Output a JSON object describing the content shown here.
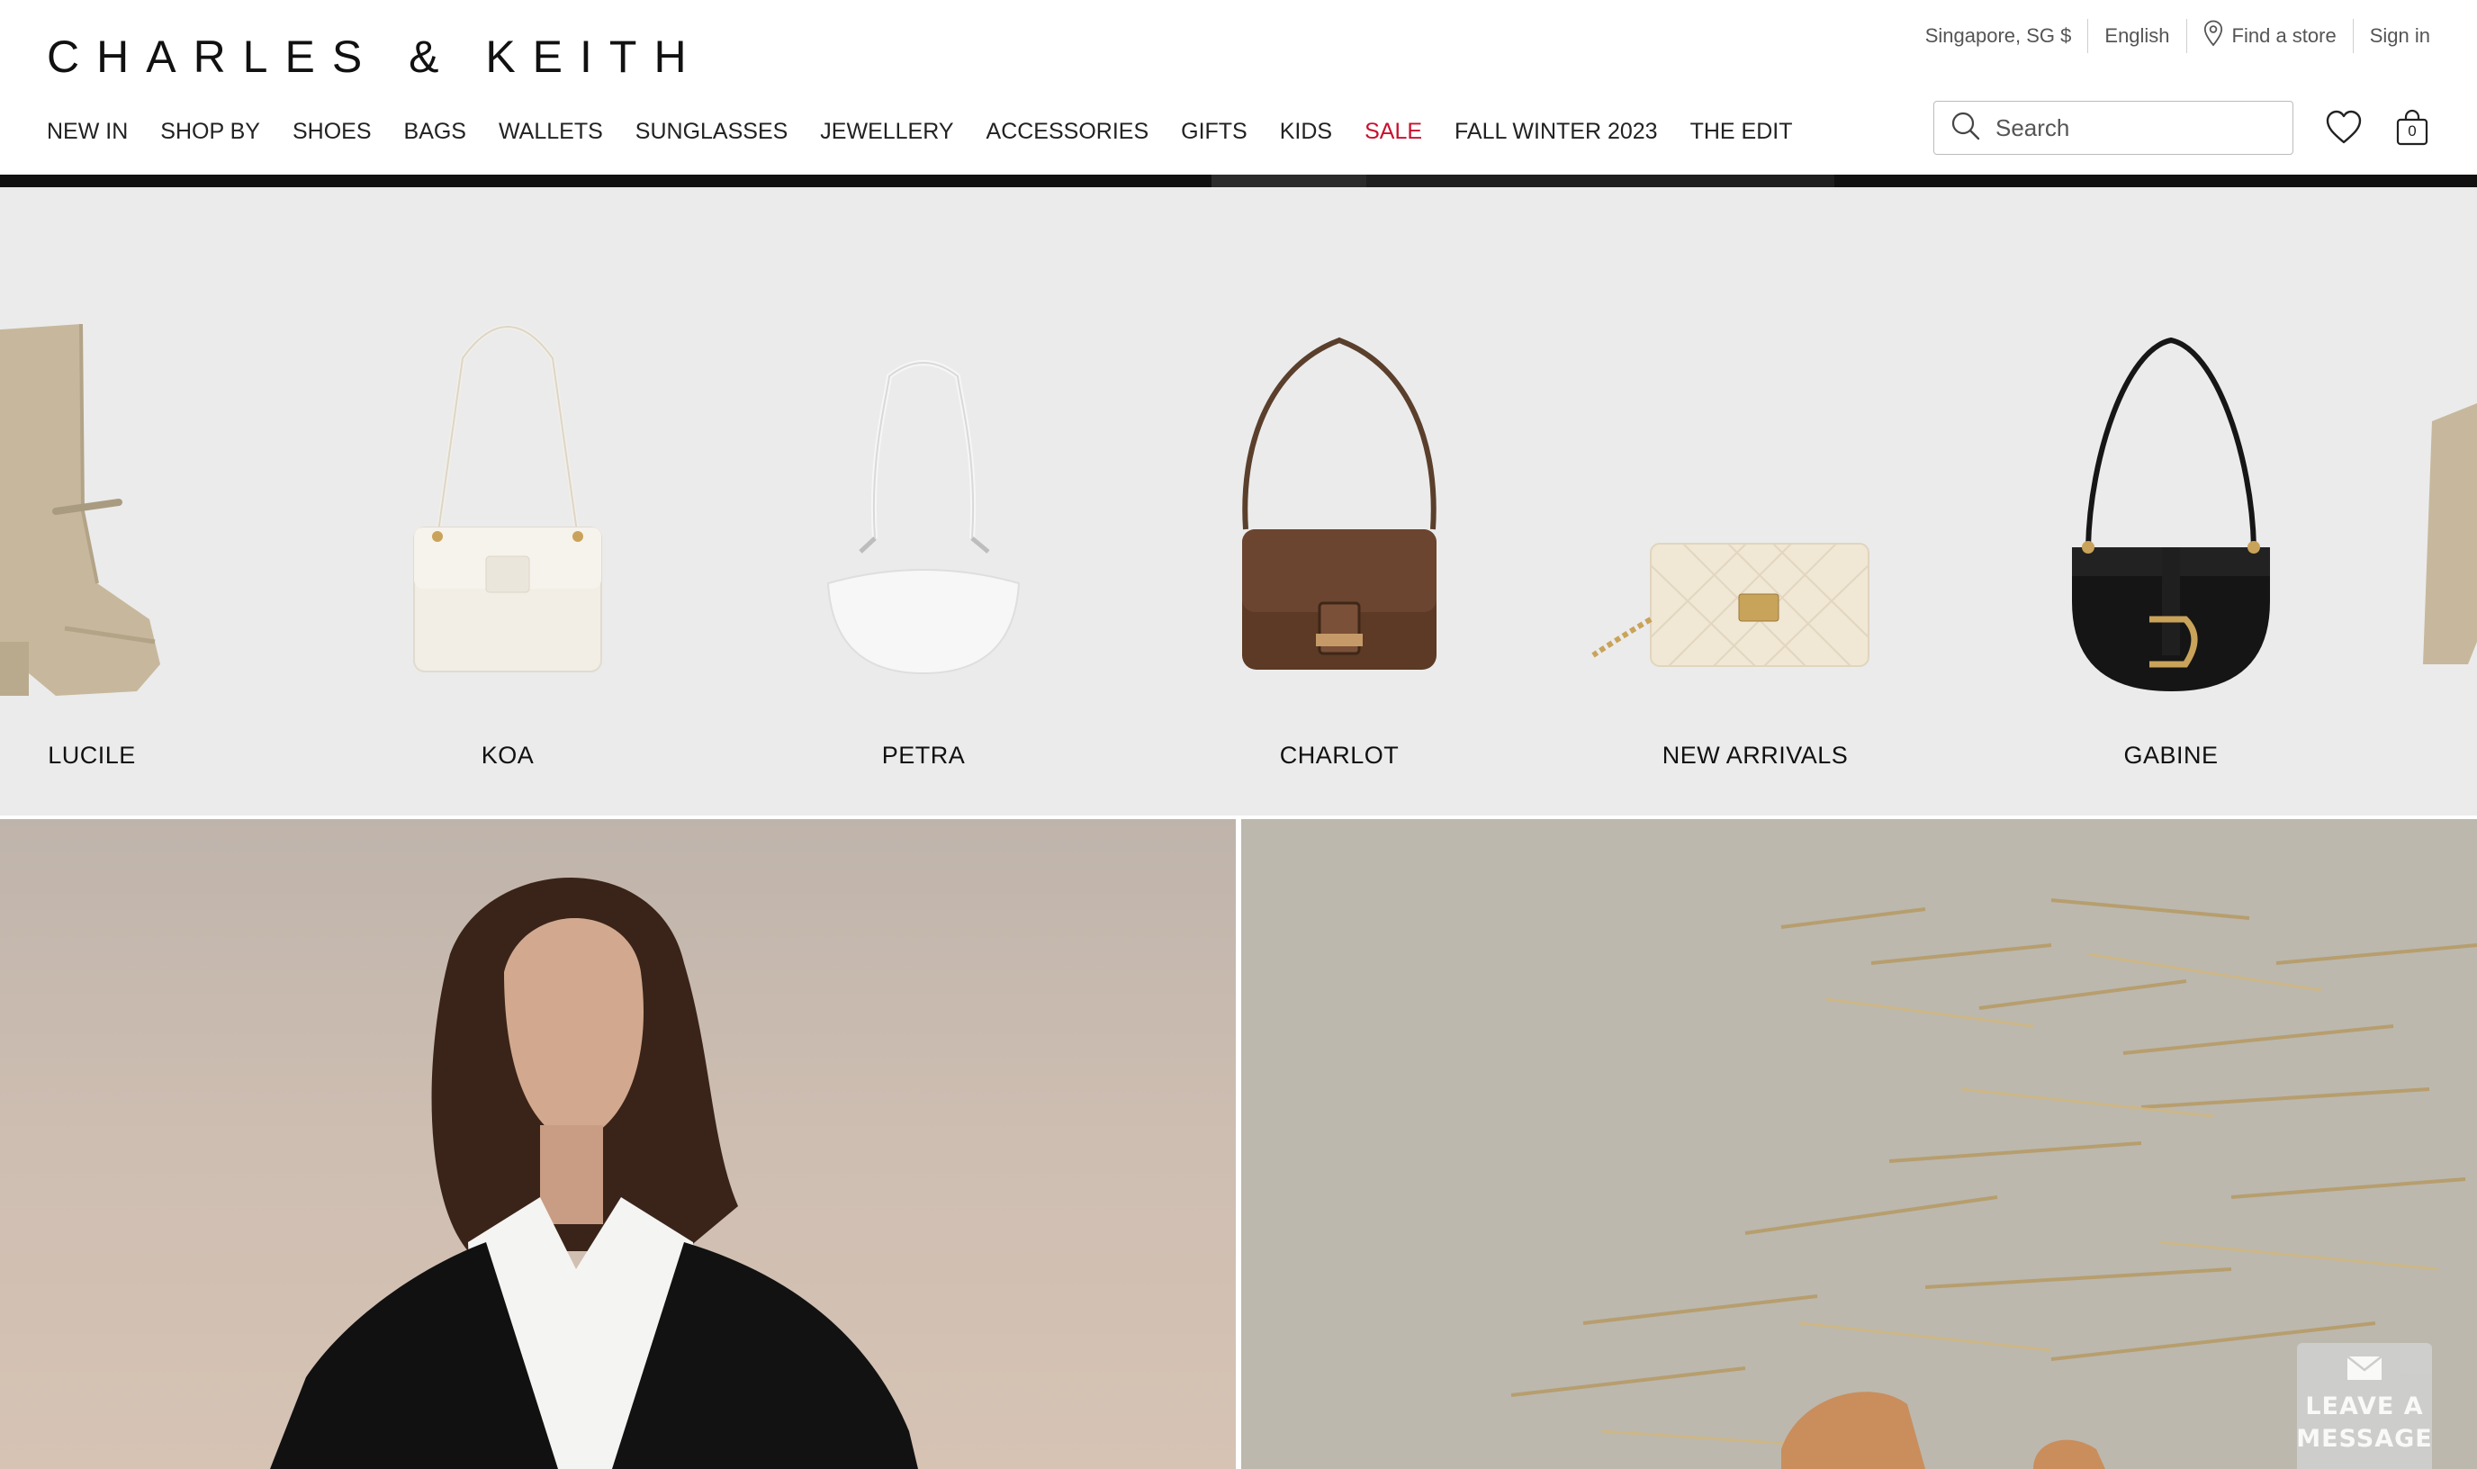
{
  "brand": {
    "logo_text": "CHARLES & KEITH"
  },
  "utility": {
    "region": "Singapore, SG $",
    "language": "English",
    "find_store": "Find a store",
    "sign_in": "Sign in"
  },
  "nav": {
    "items": [
      {
        "label": "NEW IN"
      },
      {
        "label": "SHOP BY"
      },
      {
        "label": "SHOES"
      },
      {
        "label": "BAGS"
      },
      {
        "label": "WALLETS"
      },
      {
        "label": "SUNGLASSES"
      },
      {
        "label": "JEWELLERY"
      },
      {
        "label": "ACCESSORIES"
      },
      {
        "label": "GIFTS"
      },
      {
        "label": "KIDS"
      },
      {
        "label": "SALE",
        "accent": "#c8102e"
      },
      {
        "label": "FALL WINTER 2023"
      },
      {
        "label": "THE EDIT"
      }
    ]
  },
  "search": {
    "placeholder": "Search"
  },
  "cart": {
    "count": "0"
  },
  "categories": [
    {
      "label": "LUCILE",
      "icon": "boot-icon"
    },
    {
      "label": "KOA",
      "icon": "shoulder-bag-icon"
    },
    {
      "label": "PETRA",
      "icon": "hobo-bag-icon"
    },
    {
      "label": "CHARLOT",
      "icon": "crossbody-bag-icon"
    },
    {
      "label": "NEW ARRIVALS",
      "icon": "quilted-bag-icon"
    },
    {
      "label": "GABINE",
      "icon": "saddle-bag-icon"
    }
  ],
  "chat": {
    "line1": "LEAVE A",
    "line2": "MESSAGE"
  },
  "colors": {
    "sale": "#c8102e",
    "carousel_bg": "#ebebeb",
    "text": "#111111"
  }
}
